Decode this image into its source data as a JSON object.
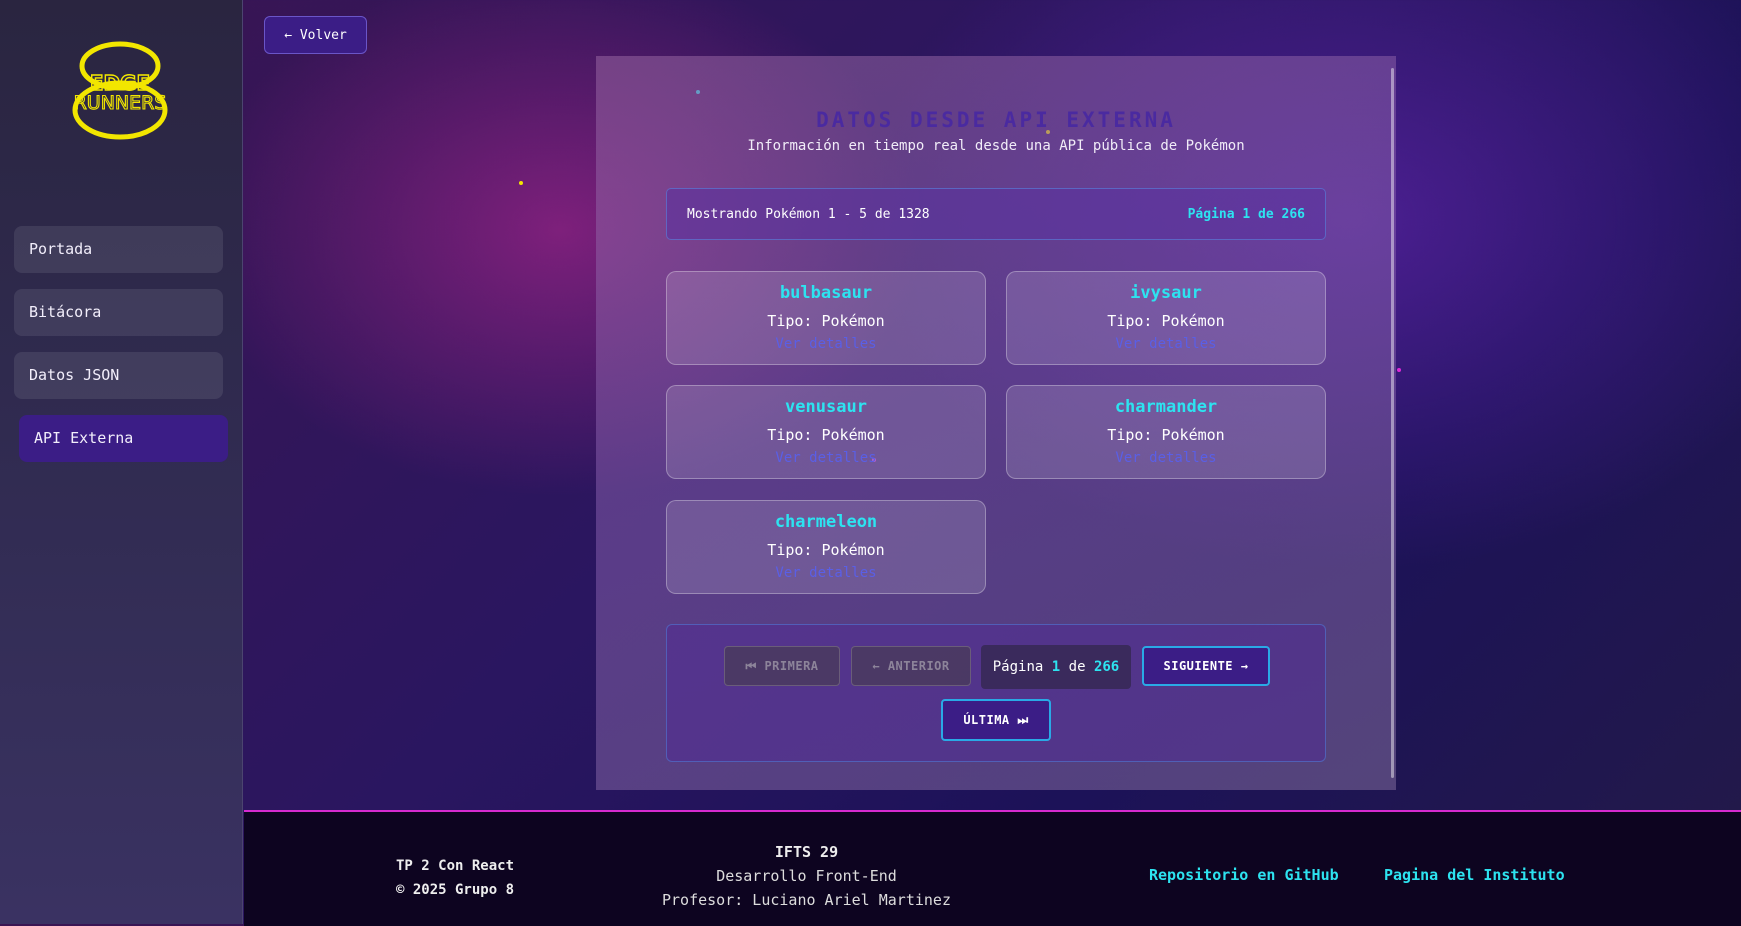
{
  "logo": {
    "number": "8",
    "line1": "EDGE",
    "line2": "RUNNERS"
  },
  "sidebar": {
    "items": [
      {
        "label": "Portada"
      },
      {
        "label": "Bitácora"
      },
      {
        "label": "Datos JSON"
      },
      {
        "label": "API Externa",
        "active": true
      }
    ]
  },
  "back_button": "← Volver",
  "main": {
    "title": "DATOS DESDE API EXTERNA",
    "subtitle": "Información en tiempo real desde una API pública de Pokémon",
    "info": {
      "showing": "Mostrando Pokémon 1 - 5 de 1328",
      "page_label": "Página 1 de 266"
    },
    "cards": [
      {
        "name": "bulbasaur",
        "type": "Tipo: Pokémon",
        "link": "Ver detalles"
      },
      {
        "name": "ivysaur",
        "type": "Tipo: Pokémon",
        "link": "Ver detalles"
      },
      {
        "name": "venusaur",
        "type": "Tipo: Pokémon",
        "link": "Ver detalles"
      },
      {
        "name": "charmander",
        "type": "Tipo: Pokémon",
        "link": "Ver detalles"
      },
      {
        "name": "charmeleon",
        "type": "Tipo: Pokémon",
        "link": "Ver detalles"
      }
    ],
    "pagination": {
      "first": "⏮ PRIMERA",
      "prev": "← ANTERIOR",
      "page_word": "Página",
      "current": "1",
      "of_word": "de",
      "total": "266",
      "next": "SIGUIENTE →",
      "last": "ÚLTIMA ⏭"
    }
  },
  "footer": {
    "left_line1": "TP 2 Con React",
    "left_line2": "© 2025 Grupo 8",
    "mid_line1": "IFTS 29",
    "mid_line2": "Desarrollo Front-End",
    "mid_line3": "Profesor: Luciano Ariel Martinez",
    "link_github": "Repositorio en GitHub",
    "link_institute": "Pagina del Instituto"
  },
  "colors": {
    "accent": "#2de3f0",
    "button_bg": "#3b1d86",
    "logo": "#f2e600",
    "footer_border": "#d62ad0",
    "link_muted": "#5a5fe6"
  }
}
